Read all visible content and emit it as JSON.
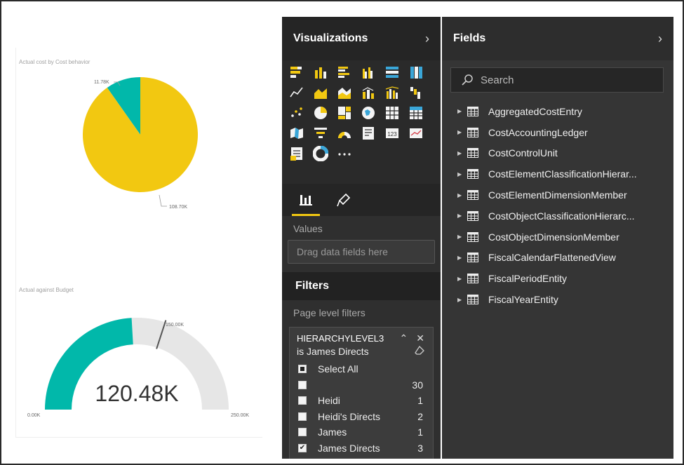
{
  "report": {
    "pie_title": "Actual cost by Cost behavior",
    "gauge_title": "Actual against Budget"
  },
  "chart_data": [
    {
      "type": "pie",
      "title": "Actual cost by Cost behavior",
      "labels": [
        "11.78K",
        "108.70K"
      ],
      "values": [
        11.78,
        108.7
      ],
      "colors": [
        "#01b8aa",
        "#f2c811"
      ]
    },
    {
      "type": "gauge",
      "title": "Actual against Budget",
      "value": 120.48,
      "value_label": "120.48K",
      "min_label": "0.00K",
      "max_label": "250.00K",
      "target_label": "150.00K",
      "min": 0,
      "max": 250,
      "target": 150,
      "colors": {
        "fill": "#01b8aa",
        "track": "#e6e6e6",
        "target": "#555555"
      }
    }
  ],
  "visualizations": {
    "title": "Visualizations",
    "icons": [
      "stacked-bar-chart-icon",
      "stacked-column-chart-icon",
      "clustered-bar-chart-icon",
      "clustered-column-chart-icon",
      "100-stacked-bar-chart-icon",
      "100-stacked-column-chart-icon",
      "line-chart-icon",
      "area-chart-icon",
      "stacked-area-chart-icon",
      "line-and-column-chart-icon",
      "line-and-clustered-column-chart-icon",
      "waterfall-chart-icon",
      "scatter-chart-icon",
      "pie-chart-icon",
      "treemap-icon",
      "map-icon",
      "table-icon",
      "matrix-icon",
      "filled-map-icon",
      "funnel-icon",
      "gauge-icon",
      "multi-row-card-icon",
      "card-icon",
      "kpi-icon",
      "slicer-icon",
      "donut-chart-icon",
      "more-visuals-icon"
    ],
    "values_label": "Values",
    "dropzone_placeholder": "Drag data fields here",
    "accent": "#f2c811"
  },
  "filters": {
    "title": "Filters",
    "page_level_label": "Page level filters",
    "card": {
      "field": "HIERARCHYLEVEL3",
      "condition": "is James Directs",
      "options": [
        {
          "label": "Select All",
          "count": "",
          "state": "partial"
        },
        {
          "label": "",
          "count": "30",
          "state": "unchecked"
        },
        {
          "label": "Heidi",
          "count": "1",
          "state": "unchecked"
        },
        {
          "label": "Heidi's Directs",
          "count": "2",
          "state": "unchecked"
        },
        {
          "label": "James",
          "count": "1",
          "state": "unchecked"
        },
        {
          "label": "James Directs",
          "count": "3",
          "state": "checked"
        }
      ]
    }
  },
  "fields": {
    "title": "Fields",
    "search_placeholder": "Search",
    "tables": [
      "AggregatedCostEntry",
      "CostAccountingLedger",
      "CostControlUnit",
      "CostElementClassificationHierar...",
      "CostElementDimensionMember",
      "CostObjectClassificationHierarc...",
      "CostObjectDimensionMember",
      "FiscalCalendarFlattenedView",
      "FiscalPeriodEntity",
      "FiscalYearEntity"
    ]
  }
}
